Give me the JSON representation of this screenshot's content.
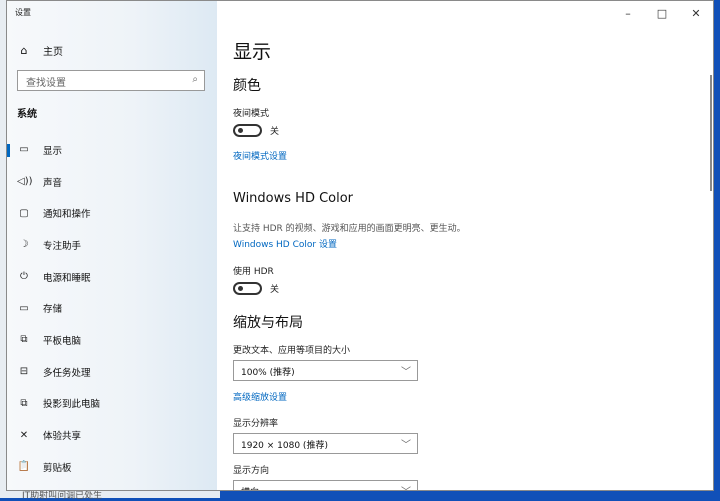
{
  "window": {
    "title": "设置",
    "minimize": "–",
    "maximize": "□",
    "close": "✕"
  },
  "sidebar": {
    "home": "主页",
    "search_placeholder": "查找设置",
    "section": "系统",
    "items": [
      {
        "label": "显示",
        "icon": "▭"
      },
      {
        "label": "声音",
        "icon": "◁))"
      },
      {
        "label": "通知和操作",
        "icon": "▢"
      },
      {
        "label": "专注助手",
        "icon": "☽"
      },
      {
        "label": "电源和睡眠",
        "icon": "⏻"
      },
      {
        "label": "存储",
        "icon": "▭"
      },
      {
        "label": "平板电脑",
        "icon": "⧉"
      },
      {
        "label": "多任务处理",
        "icon": "⊟"
      },
      {
        "label": "投影到此电脑",
        "icon": "⧉"
      },
      {
        "label": "体验共享",
        "icon": "✕"
      },
      {
        "label": "剪贴板",
        "icon": "📋"
      }
    ]
  },
  "main": {
    "title": "显示",
    "color_heading": "颜色",
    "night_label": "夜间模式",
    "night_state": "关",
    "night_link": "夜间模式设置",
    "hd_heading": "Windows HD Color",
    "hd_desc": "让支持 HDR 的视频、游戏和应用的画面更明亮、更生动。",
    "hd_link": "Windows HD Color 设置",
    "hdr_label": "使用 HDR",
    "hdr_state": "关",
    "scale_heading": "缩放与布局",
    "scale_label": "更改文本、应用等项目的大小",
    "scale_value": "100% (推荐)",
    "adv_link": "高级缩放设置",
    "res_label": "显示分辨率",
    "res_value": "1920 × 1080 (推荐)",
    "orient_label": "显示方向",
    "orient_value": "横向"
  },
  "desktop": {
    "bottom_text": "IT助射叫问调已处生"
  }
}
